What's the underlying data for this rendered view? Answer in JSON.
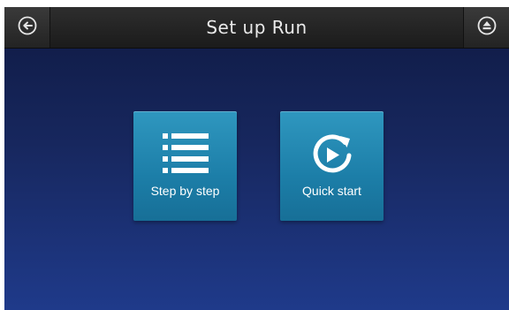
{
  "header": {
    "title": "Set up Run",
    "back_icon": "back-arrow-icon",
    "eject_icon": "eject-icon"
  },
  "tiles": [
    {
      "label": "Step by step",
      "icon": "list-icon"
    },
    {
      "label": "Quick start",
      "icon": "quick-start-play-icon"
    }
  ],
  "colors": {
    "tile": "#1f84ad",
    "header": "#252525",
    "background_top": "#0f1a43",
    "background_bottom": "#1f3a8a"
  }
}
